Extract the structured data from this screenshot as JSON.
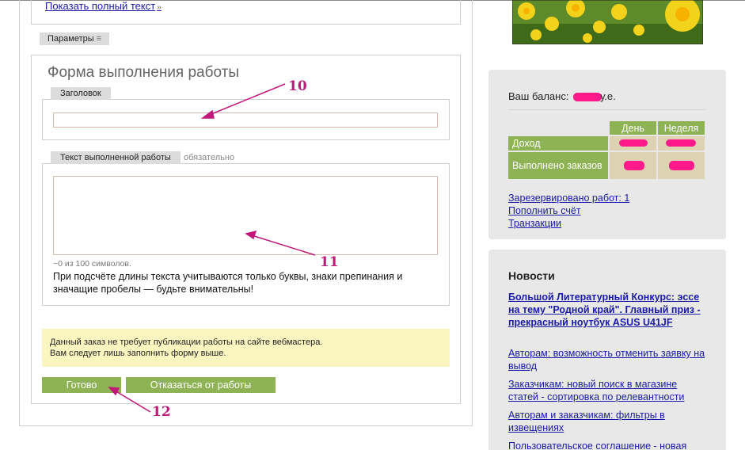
{
  "left": {
    "show_full_text": "Показать полный текст",
    "show_full_chevron": "»",
    "params_label": "Параметры",
    "params_icon": "≡"
  },
  "form": {
    "title": "Форма выполнения работы",
    "heading_label": "Заголовок",
    "heading_value": "",
    "body_label": "Текст выполненной работы",
    "body_required": "обязательно",
    "body_value": "",
    "counter": "~0 из 100 символов.",
    "hint": "При подсчёте длины текста учитываются только буквы, знаки препинания и значащие пробелы — будьте внимательны!",
    "notice_line1": "Данный заказ не требует публикации работы на сайте вебмастера.",
    "notice_line2": "Вам следует лишь заполнить форму выше.",
    "done_button": "Готово",
    "refuse_button": "Отказаться от работы"
  },
  "annotations": {
    "a10": "10",
    "a11": "11",
    "a12": "12",
    "color": "#c0197a"
  },
  "balance": {
    "label_prefix": "Ваш баланс:",
    "label_suffix": "у.е.",
    "col_day": "День",
    "col_week": "Неделя",
    "row_income": "Доход",
    "row_done": "Выполнено заказов",
    "reserved_link": "Зарезервировано работ: 1",
    "topup_link": "Пополнить счёт",
    "transactions_link": "Транзакции"
  },
  "news": {
    "title": "Новости",
    "items": [
      "Большой Литературный Конкурс: эссе на тему \"Родной край\". Главный приз - прекрасный ноутбук ASUS U41JF",
      "Авторам: возможность отменить заявку на вывод",
      "Заказчикам: новый поиск в магазине статей - сортировка по релевантности",
      "Авторам и заказчикам: фильтры в извещениях",
      "Пользовательское соглашение - новая"
    ]
  },
  "colors": {
    "accent_green": "#8eb354",
    "redaction": "#ff1a8c",
    "notice_bg": "#fbf5c0",
    "table_cell": "#ddd3b2"
  }
}
